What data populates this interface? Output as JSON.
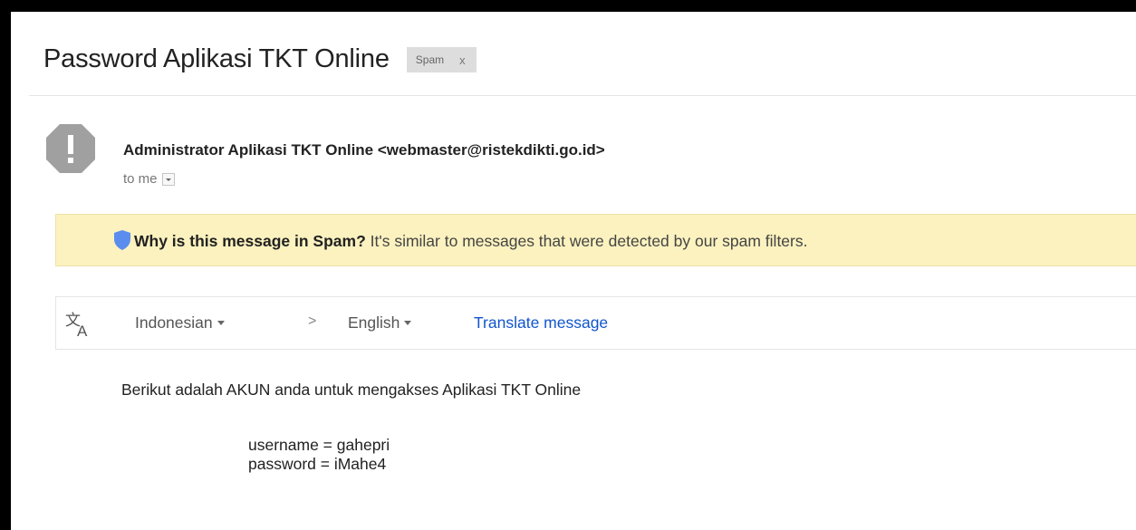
{
  "subject": "Password Aplikasi TKT Online",
  "label": {
    "text": "Spam",
    "remove": "x"
  },
  "sender": {
    "display": "Administrator Aplikasi TKT Online <webmaster@ristekdikti.go.id>",
    "to_label": "to me",
    "avatar_icon": "warning-octagon-icon"
  },
  "spam_notice": {
    "question": "Why is this message in Spam?",
    "explanation": " It's similar to messages that were detected by our spam filters.",
    "icon": "shield-icon"
  },
  "translate": {
    "icon": "translate-icon",
    "source_language": "Indonesian",
    "separator": ">",
    "target_language": "English",
    "action": "Translate message"
  },
  "message": {
    "intro": "Berikut adalah AKUN anda untuk mengakses Aplikasi TKT Online",
    "username_line": "username = gahepri",
    "password_line": "password = iMahe4"
  },
  "colors": {
    "spam_banner": "#fcf2bf",
    "link": "#1155cc",
    "shield": "#5b8def",
    "avatar": "#a0a0a0"
  }
}
